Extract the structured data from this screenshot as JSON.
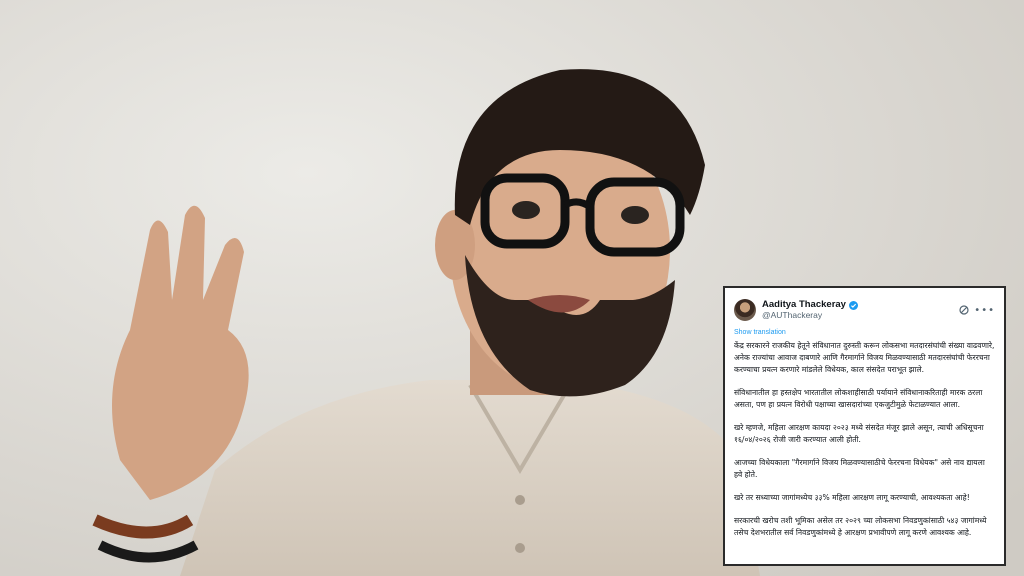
{
  "tweet": {
    "author_name": "Aaditya Thackeray",
    "handle": "@AUThackeray",
    "show_translation": "Show translation",
    "paragraphs": [
      "केंद्र सरकारने राजकीय हेतूने संविधानात दुरुस्ती करून लोकसभा मतदारसंघांची संख्या वाढवणारे, अनेक राज्यांचा आवाज दाबणारे आणि गैरमार्गाने विजय मिळवण्यासाठी मतदारसंघांची फेररचना करण्याचा प्रयत्न करणारे मांडलेले विधेयक, काल संसदेत पराभूत झाले.",
      "संविधानातील हा हस्तक्षेप भारतातील लोकशाहीसाठी पर्यायाने संविधानाकरिताही मारक ठरला असता, पण हा प्रयत्न विरोधी पक्षाच्या खासदारांच्या एकजुटीमुळे फेटाळण्यात आला.",
      "खरे म्हणजे, महिला आरक्षण कायदा २०२३ मध्ये संसदेत मंजूर झाले असून, त्याची अधिसूचना १६/०४/२०२६ रोजी जारी करण्यात आली होती.",
      "आजच्या विधेयकाला \"गैरमार्गाने विजय मिळवण्यासाठीचे फेररचना विधेयक\" असे नाव द्यायला हवे होते.",
      "खरे तर सध्याच्या जागांमध्येच ३३% महिला आरक्षण लागू करण्याची, आवश्यकता आहे!",
      "सरकारची खरोच तशी भूमिका असेल तर २०२९ च्या लोकसभा निवडणुकांसाठी ५४३ जागांमध्ये तसेच देशभरातील सर्व निवडणुकांमध्ये हे आरक्षण प्रभावीपणे लागू करणे आवश्यक आहे."
    ]
  }
}
